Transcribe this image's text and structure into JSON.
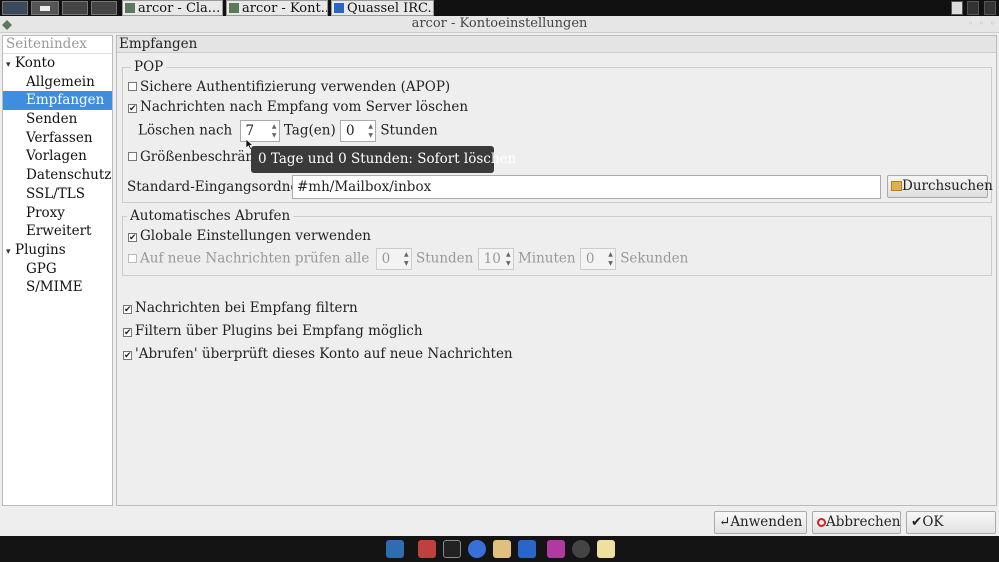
{
  "taskbar": {
    "tasks": [
      {
        "label": "arcor - Cla..."
      },
      {
        "label": "arcor - Kont..."
      },
      {
        "label": "Quassel IRC..."
      }
    ]
  },
  "window": {
    "title": "arcor - Kontoeinstellungen"
  },
  "sidebar": {
    "header": "Seitenindex",
    "items": [
      {
        "label": "Konto",
        "level": 1,
        "expanded": true
      },
      {
        "label": "Allgemein",
        "level": 2
      },
      {
        "label": "Empfangen",
        "level": 2,
        "selected": true
      },
      {
        "label": "Senden",
        "level": 2
      },
      {
        "label": "Verfassen",
        "level": 2
      },
      {
        "label": "Vorlagen",
        "level": 2
      },
      {
        "label": "Datenschutz",
        "level": 2
      },
      {
        "label": "SSL/TLS",
        "level": 2
      },
      {
        "label": "Proxy",
        "level": 2
      },
      {
        "label": "Erweitert",
        "level": 2
      },
      {
        "label": "Plugins",
        "level": 1,
        "expanded": true
      },
      {
        "label": "GPG",
        "level": 2
      },
      {
        "label": "S/MIME",
        "level": 2
      }
    ]
  },
  "page": {
    "title": "Empfangen",
    "pop": {
      "legend": "POP",
      "apop_label": "Sichere Authentifizierung verwenden (APOP)",
      "apop_checked": false,
      "delete_label": "Nachrichten nach Empfang vom Server löschen",
      "delete_checked": true,
      "delete_after_label": "Löschen nach",
      "days_value": "7",
      "days_label": "Tag(en)",
      "hours_value": "0",
      "hours_label": "Stunden",
      "size_limit_label": "Größenbeschränk",
      "size_limit_checked": false,
      "inbox_label": "Standard-Eingangsordner",
      "inbox_value": "#mh/Mailbox/inbox",
      "browse_label": "Durchsuchen"
    },
    "auto": {
      "legend": "Automatisches Abrufen",
      "global_label": "Globale Einstellungen verwenden",
      "global_checked": true,
      "check_label": "Auf neue Nachrichten prüfen alle",
      "check_checked": false,
      "hours_value": "0",
      "hours_label": "Stunden",
      "minutes_value": "10",
      "minutes_label": "Minuten",
      "seconds_value": "0",
      "seconds_label": "Sekunden"
    },
    "filter_label": "Nachrichten bei Empfang filtern",
    "filter_checked": true,
    "plugin_filter_label": "Filtern über Plugins bei Empfang möglich",
    "plugin_filter_checked": true,
    "fetch_label": "'Abrufen' überprüft dieses Konto auf neue Nachrichten",
    "fetch_checked": true
  },
  "tooltip": "0 Tage und 0 Stunden: Sofort löschen",
  "footer": {
    "apply_label": "Anwenden",
    "cancel_label": "Abbrechen",
    "ok_label": "OK"
  },
  "check_glyph": "✔",
  "colors": {
    "selection": "#3d8ee0",
    "cancel_icon": "#d22222"
  }
}
